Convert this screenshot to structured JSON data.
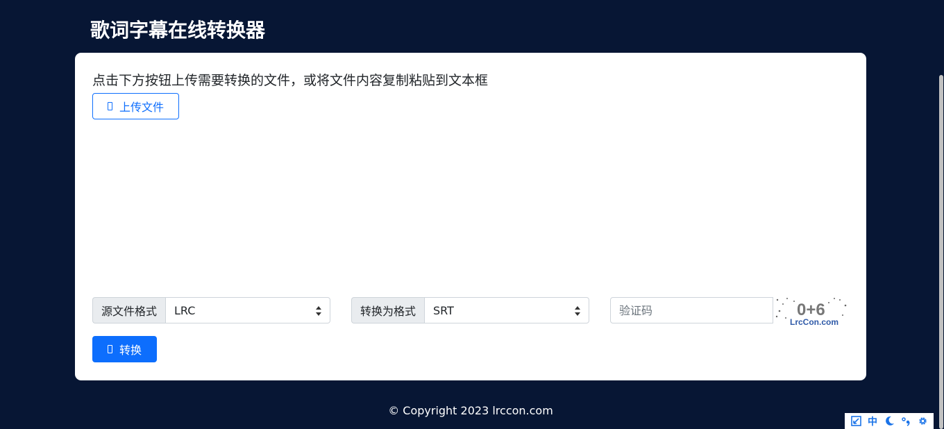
{
  "header": {
    "title": "歌词字幕在线转换器"
  },
  "main": {
    "instruction": "点击下方按钮上传需要转换的文件，或将文件内容复制粘贴到文本框",
    "upload_label": "上传文件",
    "textarea_value": "",
    "source_format": {
      "label": "源文件格式",
      "selected": "LRC"
    },
    "target_format": {
      "label": "转换为格式",
      "selected": "SRT"
    },
    "captcha": {
      "placeholder": "验证码",
      "value": "",
      "image_text": "0+6",
      "image_brand": "LrcCon.com"
    },
    "convert_label": "转换"
  },
  "footer": {
    "copyright": "© Copyright 2023 lrccon.com"
  },
  "toolbar": {
    "lang_label": "中"
  },
  "colors": {
    "background": "#071634",
    "primary": "#0d6efd",
    "card": "#ffffff"
  }
}
